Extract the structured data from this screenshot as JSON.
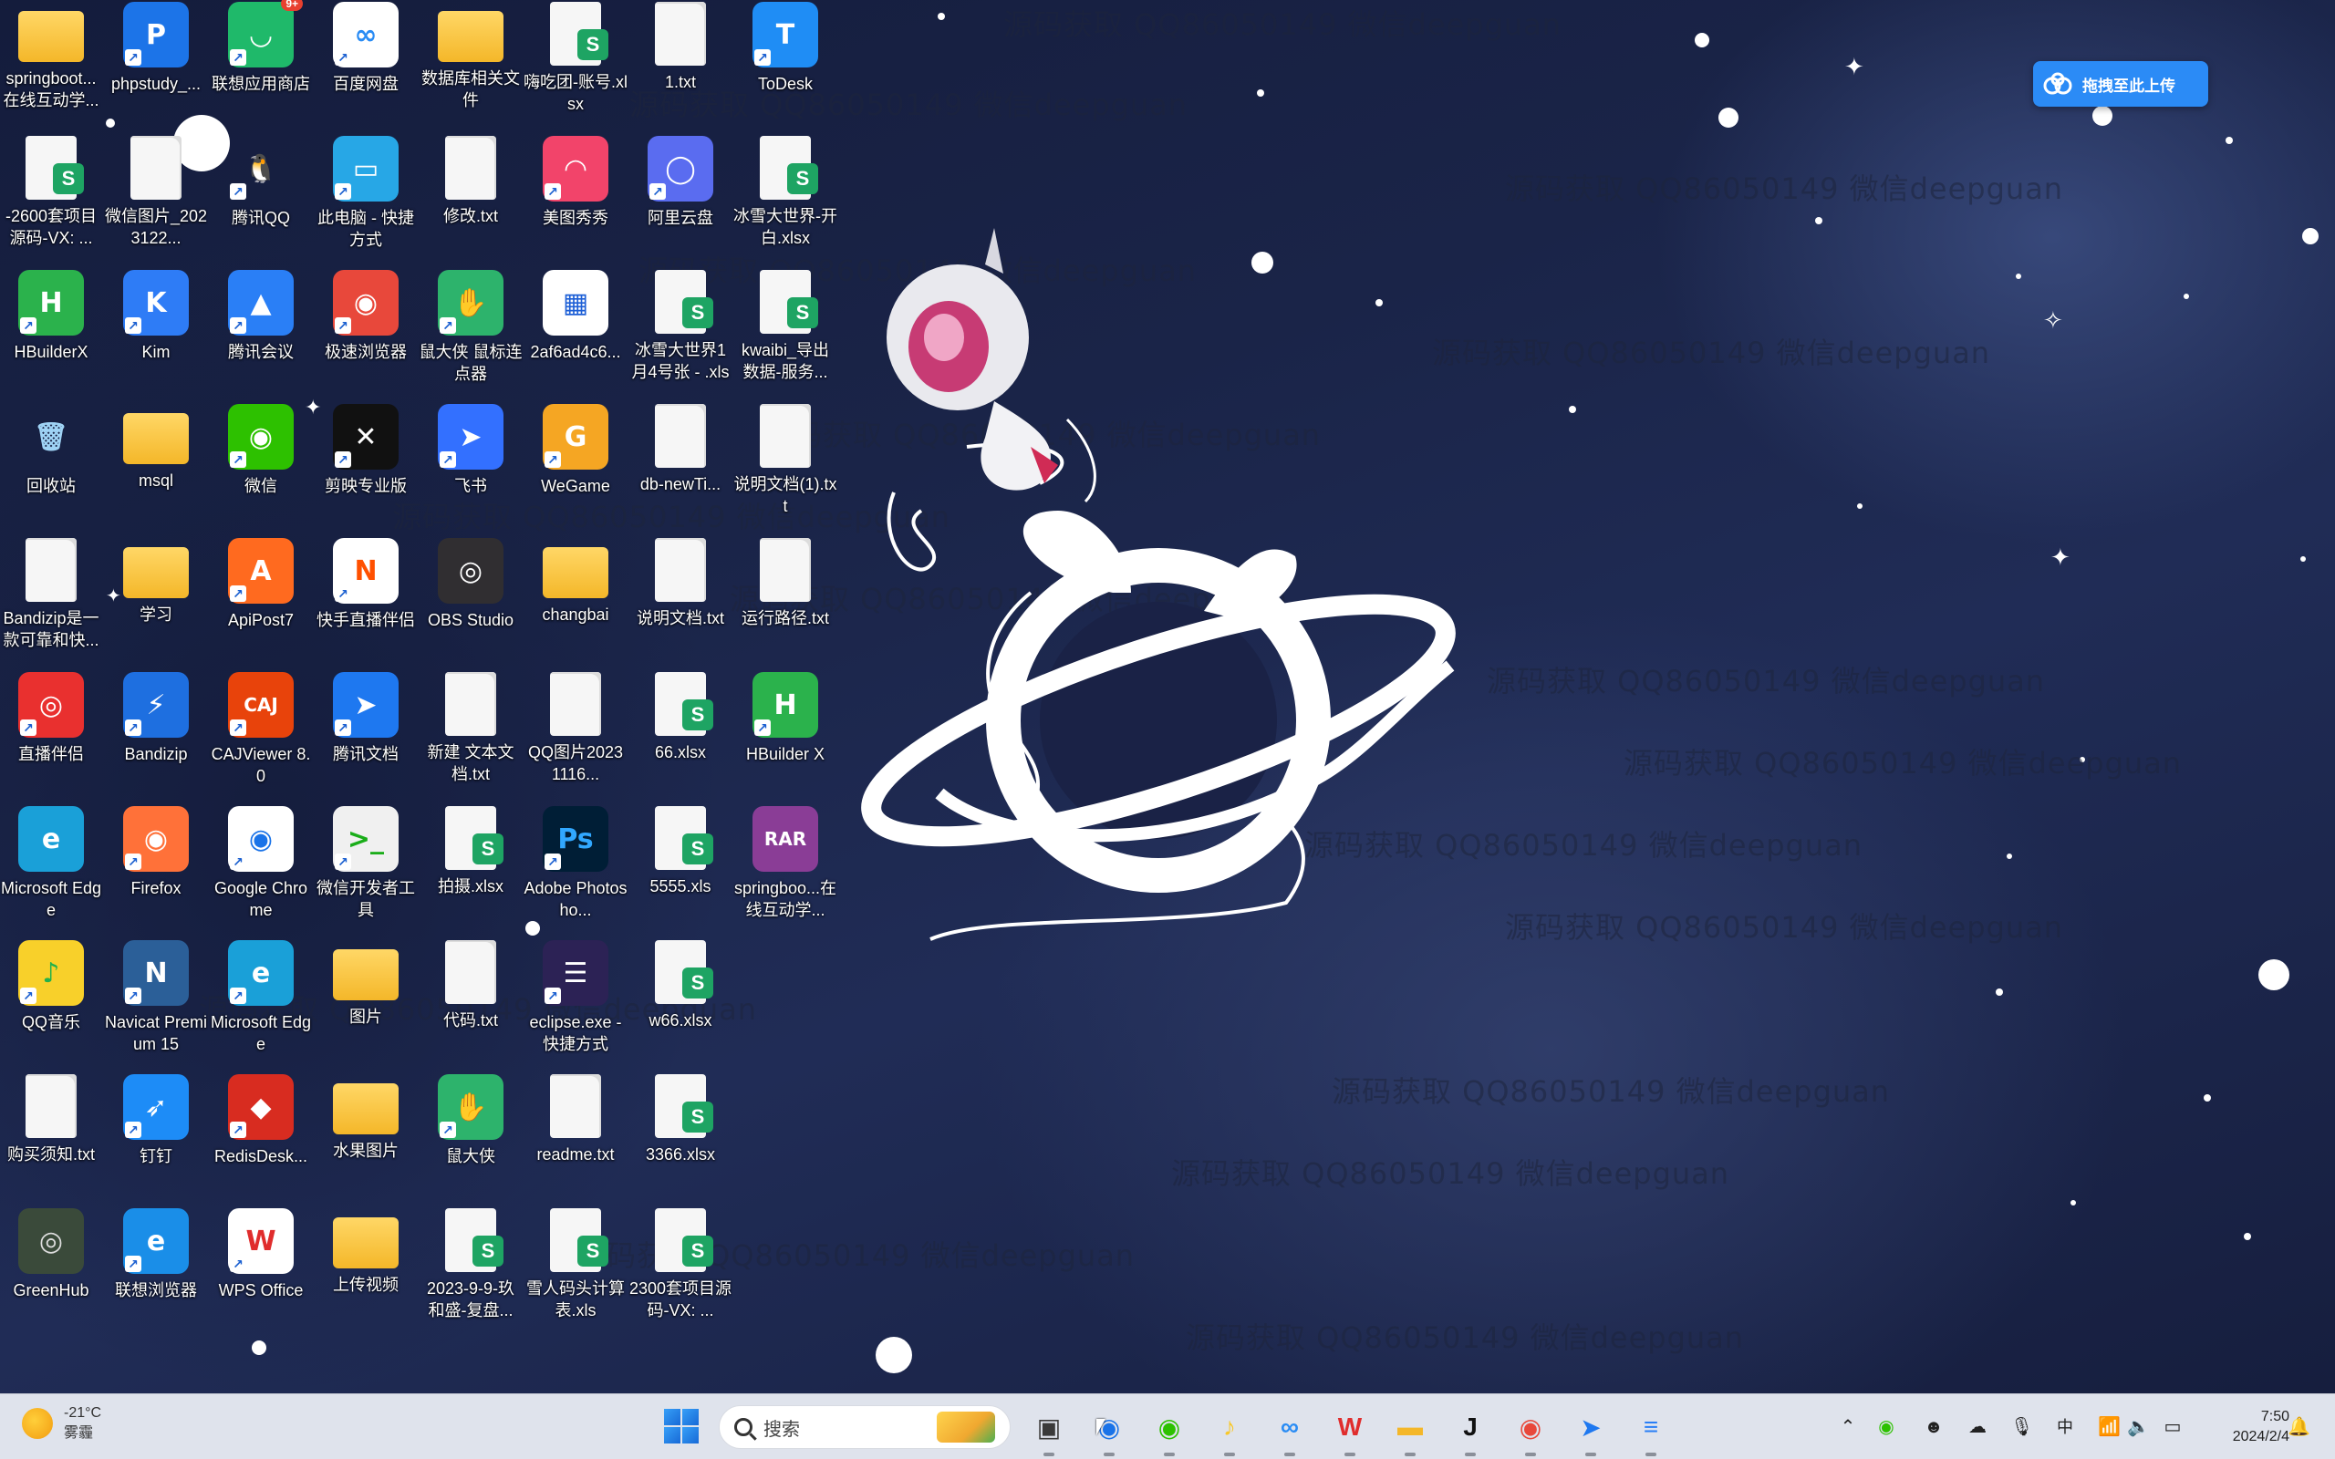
{
  "desktop": {
    "upload_badge": {
      "label": "拖拽至此上传",
      "icon": "baidu-netdisk-cloud-icon",
      "color": "#2b8bf6"
    },
    "watermark_text": "源码获取 QQ86050149 微信deepguan",
    "icons": [
      {
        "name": "springboot-folder",
        "label": "springboot...在线互动学...",
        "kind": "folder"
      },
      {
        "name": "phpstudy",
        "label": "phpstudy_...",
        "kind": "app",
        "color": "#1c74e8",
        "glyph": "P",
        "shortcut": true
      },
      {
        "name": "lenovo-app-store",
        "label": "联想应用商店",
        "kind": "app",
        "color": "#1fb96a",
        "glyph": "◡",
        "shortcut": true,
        "badge": "9+"
      },
      {
        "name": "baidu-netdisk",
        "label": "百度网盘",
        "kind": "app",
        "color": "#ffffff",
        "glyph": "∞",
        "glyph_color": "#2a8cf4",
        "shortcut": true
      },
      {
        "name": "database-folder",
        "label": "数据库相关文件",
        "kind": "folder"
      },
      {
        "name": "account-xlsx",
        "label": "嗨吃团-账号.xlsx",
        "kind": "xls"
      },
      {
        "name": "1-txt",
        "label": "1.txt",
        "kind": "file"
      },
      {
        "name": "todesk",
        "label": "ToDesk",
        "kind": "app",
        "color": "#1f8df5",
        "glyph": "T",
        "shortcut": true
      },
      {
        "name": "source-2600-file",
        "label": "-2600套项目源码-VX: ...",
        "kind": "xls"
      },
      {
        "name": "wechat-image",
        "label": "微信图片_2023122...",
        "kind": "file"
      },
      {
        "name": "tencent-qq",
        "label": "腾讯QQ",
        "kind": "app",
        "color": "transparent",
        "glyph": "🐧",
        "glyph_color": "#111",
        "shortcut": true
      },
      {
        "name": "this-pc",
        "label": "此电脑 - 快捷方式",
        "kind": "app",
        "color": "#27a7e6",
        "glyph": "▭",
        "shortcut": true
      },
      {
        "name": "modify-txt",
        "label": "修改.txt",
        "kind": "file"
      },
      {
        "name": "meitu",
        "label": "美图秀秀",
        "kind": "app",
        "color": "#f2446a",
        "glyph": "◠",
        "shortcut": true
      },
      {
        "name": "aliyun-drive",
        "label": "阿里云盘",
        "kind": "app",
        "color": "#5a6cf0",
        "glyph": "◯",
        "shortcut": true
      },
      {
        "name": "ice-snow-open-xlsx",
        "label": "冰雪大世界-开白.xlsx",
        "kind": "xls"
      },
      {
        "name": "hbuilderx",
        "label": "HBuilderX",
        "kind": "app",
        "color": "#2bb24c",
        "glyph": "H",
        "shortcut": true
      },
      {
        "name": "kim",
        "label": "Kim",
        "kind": "app",
        "color": "#2e7cf6",
        "glyph": "K",
        "shortcut": true
      },
      {
        "name": "tencent-meeting",
        "label": "腾讯会议",
        "kind": "app",
        "color": "#2a7ff6",
        "glyph": "▲",
        "shortcut": true
      },
      {
        "name": "speed-browser",
        "label": "极速浏览器",
        "kind": "app",
        "color": "#e8483b",
        "glyph": "◉",
        "shortcut": true
      },
      {
        "name": "mouse-clicker",
        "label": "鼠大侠 鼠标连点器",
        "kind": "app",
        "color": "#2db36c",
        "glyph": "✋",
        "shortcut": true
      },
      {
        "name": "qrcode-file",
        "label": "2af6ad4c6...",
        "kind": "app",
        "color": "#ffffff",
        "glyph": "▦",
        "glyph_color": "#1d5fd6"
      },
      {
        "name": "ice-snow-jan4-xls",
        "label": "冰雪大世界1月4号张 - .xls",
        "kind": "xls"
      },
      {
        "name": "kwaibi-export",
        "label": "kwaibi_导出数据-服务...",
        "kind": "xls"
      },
      {
        "name": "recycle-bin",
        "label": "回收站",
        "kind": "app",
        "color": "transparent",
        "glyph": "🗑",
        "glyph_color": "#9fd3f5"
      },
      {
        "name": "msql-folder",
        "label": "msql",
        "kind": "folder"
      },
      {
        "name": "wechat",
        "label": "微信",
        "kind": "app",
        "color": "#2dc100",
        "glyph": "◉",
        "shortcut": true
      },
      {
        "name": "capcut-pro",
        "label": "剪映专业版",
        "kind": "app",
        "color": "#111111",
        "glyph": "✕",
        "shortcut": true
      },
      {
        "name": "feishu",
        "label": "飞书",
        "kind": "app",
        "color": "#3370ff",
        "glyph": "➤",
        "shortcut": true
      },
      {
        "name": "wegame",
        "label": "WeGame",
        "kind": "app",
        "color": "#f5a623",
        "glyph": "G",
        "shortcut": true
      },
      {
        "name": "db-newti",
        "label": "db-newTi...",
        "kind": "file"
      },
      {
        "name": "readme-doc-1",
        "label": "说明文档(1).txt",
        "kind": "file"
      },
      {
        "name": "bandizip-doc",
        "label": "Bandizip是一款可靠和快...",
        "kind": "file"
      },
      {
        "name": "study-folder",
        "label": "学习",
        "kind": "folder"
      },
      {
        "name": "apipost7",
        "label": "ApiPost7",
        "kind": "app",
        "color": "#ff6a1f",
        "glyph": "A",
        "shortcut": true
      },
      {
        "name": "kuaishou-live",
        "label": "快手直播伴侣",
        "kind": "app",
        "color": "#ffffff",
        "glyph": "N",
        "glyph_color": "#ff5000",
        "shortcut": true
      },
      {
        "name": "obs-studio",
        "label": "OBS Studio",
        "kind": "app",
        "color": "#302e31",
        "glyph": "◎"
      },
      {
        "name": "changbai-folder",
        "label": "changbai",
        "kind": "folder"
      },
      {
        "name": "readme-doc-txt",
        "label": "说明文档.txt",
        "kind": "file"
      },
      {
        "name": "run-path-txt",
        "label": "运行路径.txt",
        "kind": "file"
      },
      {
        "name": "live-companion",
        "label": "直播伴侣",
        "kind": "app",
        "color": "#e9302f",
        "glyph": "◎",
        "shortcut": true
      },
      {
        "name": "bandizip",
        "label": "Bandizip",
        "kind": "app",
        "color": "#1e6fe0",
        "glyph": "⚡",
        "shortcut": true
      },
      {
        "name": "cajviewer",
        "label": "CAJViewer 8.0",
        "kind": "app",
        "color": "#e8430b",
        "glyph": "CAJ",
        "shortcut": true
      },
      {
        "name": "tencent-docs",
        "label": "腾讯文档",
        "kind": "app",
        "color": "#1e78f0",
        "glyph": "➤",
        "shortcut": true
      },
      {
        "name": "new-text-doc",
        "label": "新建 文本文档.txt",
        "kind": "file"
      },
      {
        "name": "qq-image",
        "label": "QQ图片20231116...",
        "kind": "file"
      },
      {
        "name": "66-xlsx",
        "label": "66.xlsx",
        "kind": "xls"
      },
      {
        "name": "hbuilder-x",
        "label": "HBuilder X",
        "kind": "app",
        "color": "#2bb24c",
        "glyph": "H",
        "shortcut": true
      },
      {
        "name": "microsoft-edge",
        "label": "Microsoft Edge",
        "kind": "app",
        "color": "#1aa0d8",
        "glyph": "e"
      },
      {
        "name": "firefox",
        "label": "Firefox",
        "kind": "app",
        "color": "#ff7139",
        "glyph": "◉",
        "shortcut": true
      },
      {
        "name": "google-chrome",
        "label": "Google Chrome",
        "kind": "app",
        "color": "#ffffff",
        "glyph": "◉",
        "glyph_color": "#1a73e8",
        "shortcut": true
      },
      {
        "name": "wechat-devtools",
        "label": "微信开发者工具",
        "kind": "app",
        "color": "#f0f0f0",
        "glyph": ">_",
        "glyph_color": "#1aad19",
        "shortcut": true
      },
      {
        "name": "pai-she-xlsx",
        "label": "拍摄.xlsx",
        "kind": "xls"
      },
      {
        "name": "adobe-photoshop",
        "label": "Adobe Photosho...",
        "kind": "app",
        "color": "#001e36",
        "glyph": "Ps",
        "glyph_color": "#31a8ff",
        "shortcut": true
      },
      {
        "name": "5555-xls",
        "label": "5555.xls",
        "kind": "xls"
      },
      {
        "name": "springboot-rar",
        "label": "springboo...在线互动学...",
        "kind": "app",
        "color": "#8a3d96",
        "glyph": "RAR"
      },
      {
        "name": "qq-music",
        "label": "QQ音乐",
        "kind": "app",
        "color": "#f8d02a",
        "glyph": "♪",
        "glyph_color": "#22b14c",
        "shortcut": true
      },
      {
        "name": "navicat",
        "label": "Navicat Premium 15",
        "kind": "app",
        "color": "#2b5f98",
        "glyph": "N",
        "shortcut": true
      },
      {
        "name": "microsoft-edge-2",
        "label": "Microsoft Edge",
        "kind": "app",
        "color": "#1aa0d8",
        "glyph": "e",
        "shortcut": true
      },
      {
        "name": "pictures-folder",
        "label": "图片",
        "kind": "folder"
      },
      {
        "name": "code-txt",
        "label": "代码.txt",
        "kind": "file"
      },
      {
        "name": "eclipse",
        "label": "eclipse.exe - 快捷方式",
        "kind": "app",
        "color": "#2c2255",
        "glyph": "☰",
        "shortcut": true
      },
      {
        "name": "w66-xlsx",
        "label": "w66.xlsx",
        "kind": "xls"
      },
      {
        "name": "empty-1",
        "label": "",
        "kind": "none"
      },
      {
        "name": "purchase-notice-txt",
        "label": "购买须知.txt",
        "kind": "file"
      },
      {
        "name": "dingtalk",
        "label": "钉钉",
        "kind": "app",
        "color": "#1d8cf7",
        "glyph": "➶",
        "shortcut": true
      },
      {
        "name": "redis-desktop",
        "label": "RedisDesk...",
        "kind": "app",
        "color": "#d82c20",
        "glyph": "◆",
        "shortcut": true
      },
      {
        "name": "fruit-pictures-folder",
        "label": "水果图片",
        "kind": "folder"
      },
      {
        "name": "shudaxia",
        "label": "鼠大侠",
        "kind": "app",
        "color": "#2db36c",
        "glyph": "✋",
        "shortcut": true
      },
      {
        "name": "readme-txt",
        "label": "readme.txt",
        "kind": "file"
      },
      {
        "name": "3366-xlsx",
        "label": "3366.xlsx",
        "kind": "xls"
      },
      {
        "name": "empty-2",
        "label": "",
        "kind": "none"
      },
      {
        "name": "greenhub",
        "label": "GreenHub",
        "kind": "app",
        "color": "#3a4a3a",
        "glyph": "◎",
        "glyph_color": "#ddd"
      },
      {
        "name": "lenovo-browser",
        "label": "联想浏览器",
        "kind": "app",
        "color": "#1a8ee8",
        "glyph": "e",
        "shortcut": true
      },
      {
        "name": "wps-office",
        "label": "WPS Office",
        "kind": "app",
        "color": "#ffffff",
        "glyph": "W",
        "glyph_color": "#e02d2d",
        "shortcut": true
      },
      {
        "name": "upload-video-folder",
        "label": "上传视频",
        "kind": "folder"
      },
      {
        "name": "2023-9-9-xls",
        "label": "2023-9-9-玖和盛-复盘...",
        "kind": "xls"
      },
      {
        "name": "snowman-calc-xls",
        "label": "雪人码头计算表.xls",
        "kind": "xls"
      },
      {
        "name": "source-2300-file",
        "label": "2300套项目源码-VX: ...",
        "kind": "xls"
      },
      {
        "name": "empty-3",
        "label": "",
        "kind": "none"
      }
    ]
  },
  "taskbar": {
    "weather": {
      "temp": "-21°C",
      "condition": "雾霾",
      "icon": "sun-haze-icon"
    },
    "start_icon": "windows-start-icon",
    "search_placeholder": "搜索",
    "apps": [
      {
        "name": "task-view",
        "glyph": "▣",
        "color": "#3a3a3a"
      },
      {
        "name": "chrome",
        "glyph": "◉",
        "color": "#1a73e8"
      },
      {
        "name": "wechat",
        "glyph": "◉",
        "color": "#2dc100"
      },
      {
        "name": "qq-music",
        "glyph": "♪",
        "color": "#f8c82a"
      },
      {
        "name": "baidu-netdisk",
        "glyph": "∞",
        "color": "#2a8cf4"
      },
      {
        "name": "wps",
        "glyph": "W",
        "color": "#e02d2d"
      },
      {
        "name": "file-explorer",
        "glyph": "▬",
        "color": "#f4b729"
      },
      {
        "name": "jetbrains-ide",
        "glyph": "J",
        "color": "#111111"
      },
      {
        "name": "speed-browser",
        "glyph": "◉",
        "color": "#e8483b"
      },
      {
        "name": "tencent-docs",
        "glyph": "➤",
        "color": "#1e78f0"
      },
      {
        "name": "notepad",
        "glyph": "≡",
        "color": "#2a7ff6"
      }
    ],
    "tray": [
      "chevron-up-icon",
      "wechat-tray-icon",
      "qq-tray-icon",
      "onedrive-icon",
      "microphone-icon",
      "ime-icon",
      "wifi-icon",
      "volume-icon",
      "battery-icon"
    ],
    "ime_label": "中",
    "clock": {
      "time": "7:50",
      "date": "2024/2/4"
    },
    "notification_icon": "bell-icon"
  }
}
